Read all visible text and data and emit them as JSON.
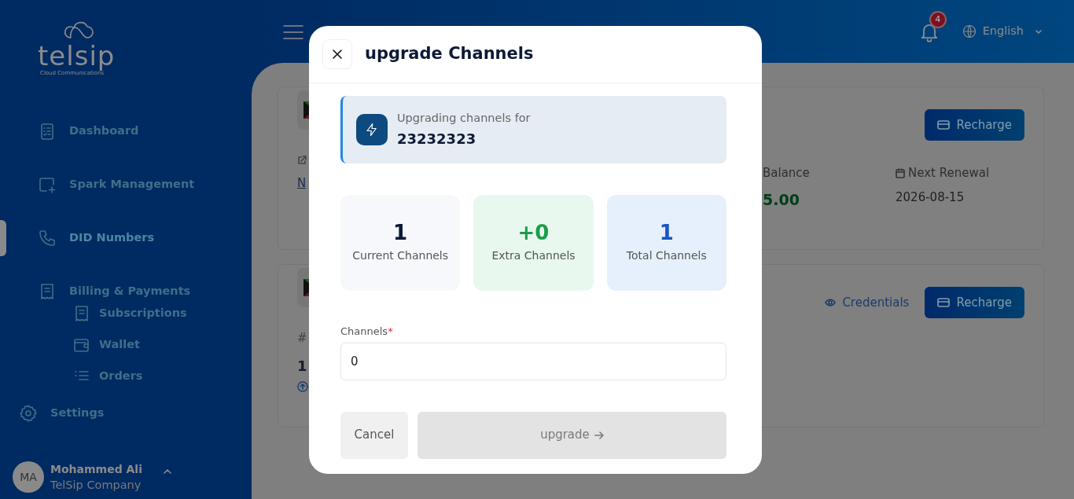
{
  "sidebar": {
    "logo": {
      "wordmark": "telsip",
      "tagline": "Cloud Communications"
    },
    "items": [
      {
        "label": "Dashboard",
        "selected": false
      },
      {
        "label": "Spark Management",
        "selected": false
      },
      {
        "label": "DID Numbers",
        "selected": true
      },
      {
        "label": "Billing & Payments",
        "selected": false,
        "children": [
          {
            "label": "Subscriptions"
          },
          {
            "label": "Wallet"
          },
          {
            "label": "Orders"
          }
        ]
      },
      {
        "label": "Settings",
        "selected": false
      }
    ],
    "user": {
      "initials": "MA",
      "name": "Mohammed Ali",
      "company": "TelSip Company"
    }
  },
  "header": {
    "notifications": "4",
    "language": "English"
  },
  "cards": [
    {
      "link": "N",
      "balance_label": "Balance",
      "balance": "5.00",
      "renewal_label": "Next Renewal",
      "renewal": "2026-08-15",
      "button": "Recharge"
    },
    {
      "hash": "#",
      "count": "1",
      "credentials": "Credentials",
      "button": "Recharge"
    }
  ],
  "modal": {
    "title": "upgrade Channels",
    "info_label": "Upgrading channels for",
    "number": "23232323",
    "stats": [
      {
        "kind": "current",
        "value": "1",
        "label": "Current Channels"
      },
      {
        "kind": "extra",
        "value": "+0",
        "label": "Extra Channels"
      },
      {
        "kind": "total",
        "value": "1",
        "label": "Total Channels"
      }
    ],
    "field": {
      "label": "Channels",
      "required": true,
      "required_mark": "*",
      "value": "0"
    },
    "cancel": "Cancel",
    "submit": {
      "label": "upgrade",
      "disabled": true
    }
  }
}
